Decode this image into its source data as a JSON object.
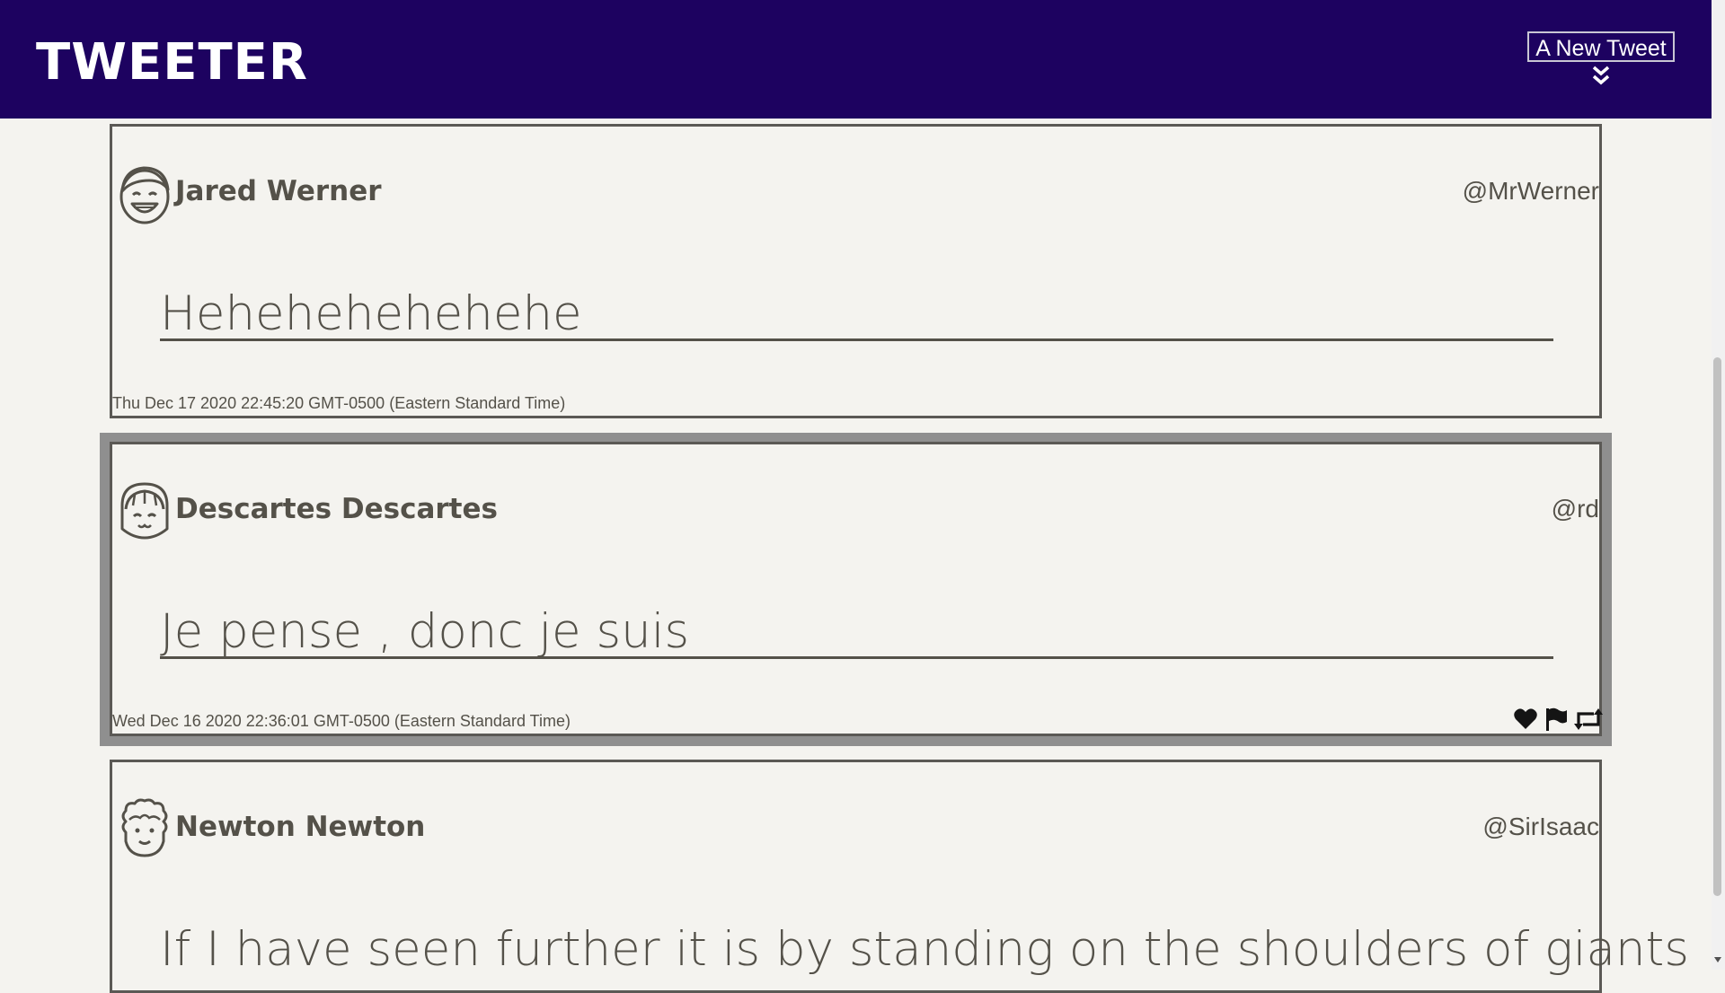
{
  "header": {
    "brand": "TWEETER",
    "new_tweet_label": "A New Tweet"
  },
  "tweets": [
    {
      "name": "Jared Werner",
      "handle": "@MrWerner",
      "text": "Hehehehehehehe",
      "timestamp": "Thu Dec 17 2020 22:45:20 GMT-0500 (Eastern Standard Time)",
      "avatar": "laughing-boy-avatar-icon"
    },
    {
      "name": "Descartes Descartes",
      "handle": "@rd",
      "text": "Je pense , donc je suis",
      "timestamp": "Wed Dec 16 2020 22:36:01 GMT-0500 (Eastern Standard Time)",
      "avatar": "girl-bangs-avatar-icon",
      "actions": [
        "heart-icon",
        "flag-icon",
        "retweet-icon"
      ]
    },
    {
      "name": "Newton Newton",
      "handle": "@SirIsaac",
      "text": "If I have seen further it is by standing on the shoulders of giants",
      "avatar": "curly-hair-avatar-icon"
    }
  ],
  "colors": {
    "nav_bg": "#1d0260",
    "page_bg": "#f4f3ef",
    "text": "#545149",
    "hover_frame": "#8f8f8f"
  }
}
